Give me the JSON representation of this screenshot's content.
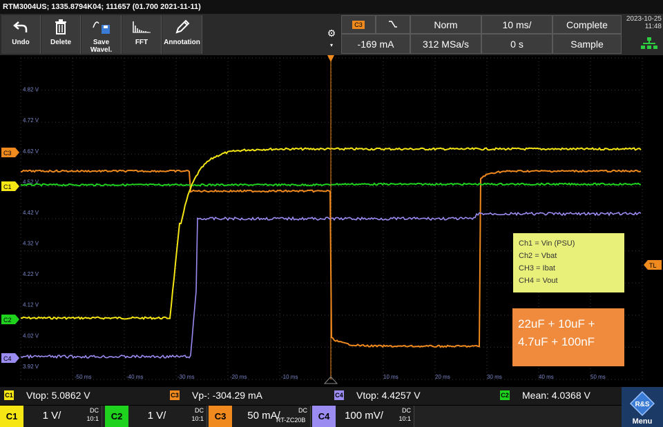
{
  "title": "RTM3004US; 1335.8794K04; 111657 (01.700 2021-11-11)",
  "toolbar": {
    "undo": "Undo",
    "delete": "Delete",
    "save_wave": "Save Wavel.",
    "fft": "FFT",
    "annotation": "Annotation"
  },
  "header": {
    "trigger_source": "C3",
    "slope_symbol": "⌐",
    "trigger_mode": "Norm",
    "timebase": "10 ms/",
    "acq_status": "Complete",
    "trigger_level": "-169 mA",
    "sample_rate": "312 MSa/s",
    "time_offset": "0 s",
    "acq_mode": "Sample",
    "date": "2023-10-25",
    "time": "11:48"
  },
  "plot": {
    "y_labels": [
      "4.82 V",
      "4.72 V",
      "4.62 V",
      "4.52 V",
      "4.42 V",
      "4.32 V",
      "4.22 V",
      "4.12 V",
      "4.02 V",
      "3.92 V"
    ],
    "x_labels": [
      "-50 ms",
      "-40 ms",
      "-30 ms",
      "-20 ms",
      "-10 ms",
      "10 ms",
      "20 ms",
      "30 ms",
      "40 ms",
      "50 ms"
    ],
    "markers": {
      "c3": "C3",
      "c1": "C1",
      "c2": "C2",
      "c4": "C4",
      "tl": "TL"
    },
    "colors": {
      "c1": "#f5e614",
      "c2": "#1ed21e",
      "c3": "#f08a1e",
      "c4": "#9a8cf0",
      "grid": "#3a3a3a"
    }
  },
  "notes": {
    "legend": [
      "Ch1 = Vin (PSU)",
      "Ch2 = Vbat",
      "CH3 = Ibat",
      "CH4 = Vout"
    ],
    "caps_line1": "22uF + 10uF +",
    "caps_line2": "4.7uF + 100nF"
  },
  "measurements": [
    {
      "ch": "C1",
      "text": "Vtop: 5.0862 V"
    },
    {
      "ch": "C3",
      "text": "Vp-: -304.29 mA"
    },
    {
      "ch": "C4",
      "text": "Vtop: 4.4257 V"
    },
    {
      "ch": "C2",
      "text": "Mean: 4.0368 V"
    }
  ],
  "channels": [
    {
      "tag": "C1",
      "scale": "1 V/",
      "coupling": "DC",
      "probe": "10:1"
    },
    {
      "tag": "C2",
      "scale": "1 V/",
      "coupling": "DC",
      "probe": "10:1"
    },
    {
      "tag": "C3",
      "scale": "50 mA/",
      "sub": "RT-ZC20B",
      "coupling": "DC",
      "probe": ""
    },
    {
      "tag": "C4",
      "scale": "100 mV/",
      "coupling": "DC",
      "probe": "10:1"
    }
  ],
  "menu_label": "Menu"
}
